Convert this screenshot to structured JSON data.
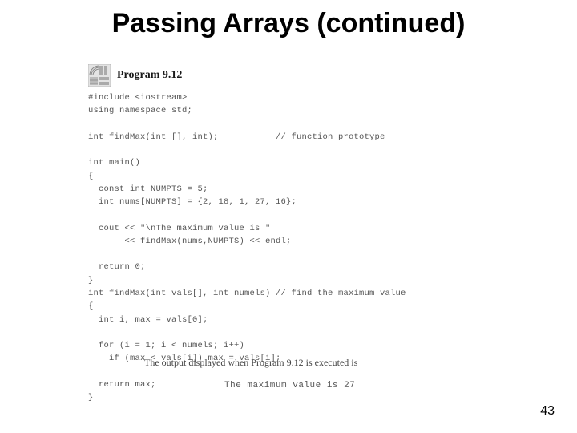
{
  "title": "Passing Arrays (continued)",
  "program": {
    "label": "Program 9.12",
    "code": "#include <iostream>\nusing namespace std;\n\nint findMax(int [], int);           // function prototype\n\nint main()\n{\n  const int NUMPTS = 5;\n  int nums[NUMPTS] = {2, 18, 1, 27, 16};\n\n  cout << \"\\nThe maximum value is \"\n       << findMax(nums,NUMPTS) << endl;\n\n  return 0;\n}\nint findMax(int vals[], int numels) // find the maximum value\n{\n  int i, max = vals[0];\n\n  for (i = 1; i < numels; i++)\n    if (max < vals[i]) max = vals[i];\n\n  return max;\n}"
  },
  "output": {
    "caption": "The output displayed when Program 9.12 is executed is",
    "line": "The maximum value is 27"
  },
  "page_number": "43"
}
